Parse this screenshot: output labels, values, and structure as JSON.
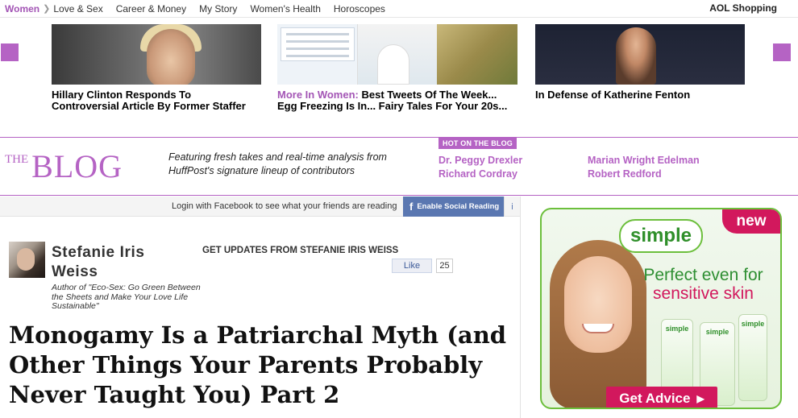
{
  "nav": {
    "brand": "Women",
    "items": [
      "Love & Sex",
      "Career & Money",
      "My Story",
      "Women's Health",
      "Horoscopes"
    ],
    "right_link": "AOL Shopping"
  },
  "carousel": {
    "slides": [
      {
        "caption": "Hillary Clinton Responds To Controversial Article By Former Staffer"
      },
      {
        "prefix": "More In Women:",
        "caption": "Best Tweets Of The Week... Egg Freezing Is In... Fairy Tales For Your 20s..."
      },
      {
        "caption": "In Defense of Katherine Fenton"
      }
    ]
  },
  "blog": {
    "logo_the": "THE",
    "logo_blog": "BLOG",
    "tagline": "Featuring fresh takes and real-time analysis from HuffPost's signature lineup of contributors",
    "hot_label": "HOT ON THE BLOG",
    "hot_links": [
      "Dr. Peggy Drexler",
      "Richard Cordray",
      "Marian Wright Edelman",
      "Robert Redford"
    ]
  },
  "social": {
    "prompt": "Login with Facebook to see what your friends are reading",
    "button_label": "Enable Social Reading",
    "info": "i"
  },
  "author": {
    "name_line1": "Stefanie Iris",
    "name_line2": "Weiss",
    "bio": "Author of \"Eco-Sex: Go Green Between the Sheets and Make Your Love Life Sustainable\"",
    "updates_label": "GET UPDATES FROM STEFANIE IRIS WEISS",
    "like_label": "Like",
    "like_count": "25"
  },
  "article": {
    "headline": "Monogamy Is a Patriarchal Myth (and Other Things Your Parents Probably Never Taught You) Part 2"
  },
  "ad": {
    "tag": "new",
    "brand": "simple",
    "slogan_line1": "Perfect even for",
    "slogan_line2": "sensitive skin",
    "cta": "Get Advice",
    "products": [
      "simple",
      "simple",
      "simple"
    ]
  },
  "colors": {
    "accent": "#b563c4",
    "facebook": "#5a77b1",
    "ad_pink": "#d2185d",
    "ad_green": "#2e8f32"
  }
}
